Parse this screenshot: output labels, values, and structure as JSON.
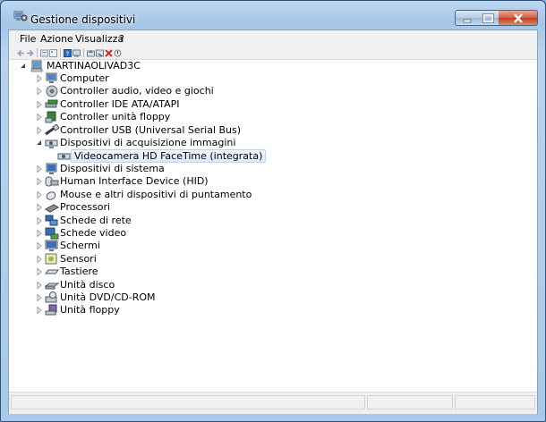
{
  "window": {
    "title": "Gestione dispositivi"
  },
  "menu": {
    "file": "File",
    "azione": "Azione",
    "visualizza": "Visualizza",
    "help": "?"
  },
  "tree": {
    "root": "MARTINAOLIVAD3C",
    "items": [
      {
        "label": "Computer",
        "icon": "computer-icon"
      },
      {
        "label": "Controller audio, video e giochi",
        "icon": "speaker-icon"
      },
      {
        "label": "Controller IDE ATA/ATAPI",
        "icon": "ide-controller-icon"
      },
      {
        "label": "Controller unità floppy",
        "icon": "floppy-controller-icon"
      },
      {
        "label": "Controller USB (Universal Serial Bus)",
        "icon": "usb-icon"
      },
      {
        "label": "Dispositivi di acquisizione immagini",
        "icon": "camera-icon"
      },
      {
        "label": "Videocamera HD FaceTime (integrata)",
        "icon": "webcam-icon"
      },
      {
        "label": "Dispositivi di sistema",
        "icon": "system-device-icon"
      },
      {
        "label": "Human Interface Device (HID)",
        "icon": "hid-icon"
      },
      {
        "label": "Mouse e altri dispositivi di puntamento",
        "icon": "mouse-icon"
      },
      {
        "label": "Processori",
        "icon": "processor-icon"
      },
      {
        "label": "Schede di rete",
        "icon": "network-card-icon"
      },
      {
        "label": "Schede video",
        "icon": "display-adapter-icon"
      },
      {
        "label": "Schermi",
        "icon": "monitor-icon"
      },
      {
        "label": "Sensori",
        "icon": "sensor-icon"
      },
      {
        "label": "Tastiere",
        "icon": "keyboard-icon"
      },
      {
        "label": "Unità disco",
        "icon": "disk-drive-icon"
      },
      {
        "label": "Unità DVD/CD-ROM",
        "icon": "dvd-drive-icon"
      },
      {
        "label": "Unità floppy",
        "icon": "floppy-drive-icon"
      }
    ]
  },
  "colors": {
    "selection": "#dcebfc",
    "window_frame": "#a6c6e6",
    "close_button": "#c43a18"
  }
}
